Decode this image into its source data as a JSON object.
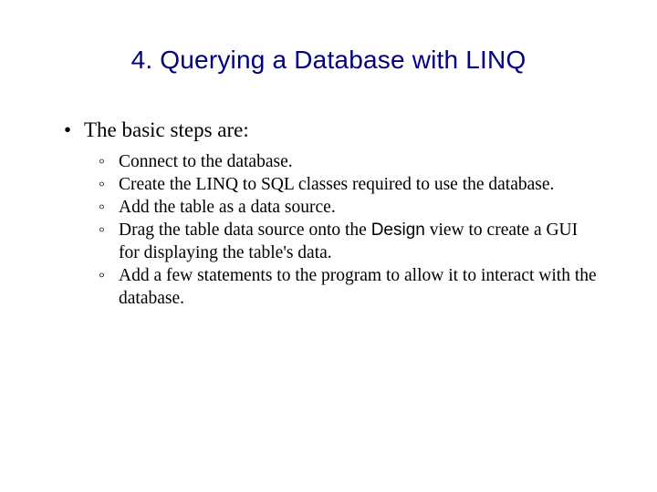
{
  "title": "4. Querying a Database with LINQ",
  "main_bullet": "The basic steps are:",
  "sub_items": {
    "s0": "Connect to the database.",
    "s1": "Create the LINQ to SQL classes required to use the database.",
    "s2": "Add the table as a data source.",
    "s3_a": "Drag the table data source onto the ",
    "s3_design": "Design",
    "s3_b": " view to create a GUI for displaying the table's data.",
    "s4": "Add a few statements to the program to allow it to interact with the database."
  }
}
